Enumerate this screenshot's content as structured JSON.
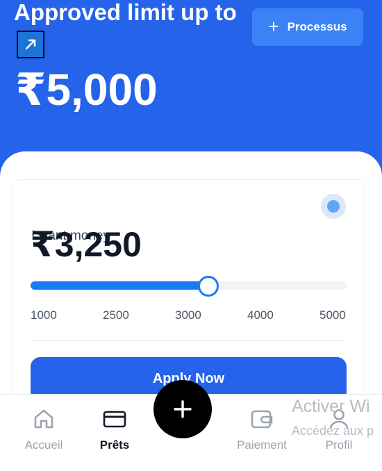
{
  "header": {
    "title": "Approved limit up to",
    "limit_amount": "₹5,000",
    "process_button_label": "Processus"
  },
  "loan_card": {
    "want_label": "I want money",
    "amount": "₹3,250",
    "slider": {
      "min": 1000,
      "max": 5000,
      "value": 3250,
      "fill_percent": 56,
      "ticks": [
        "1000",
        "2500",
        "3000",
        "4000",
        "5000"
      ]
    },
    "apply_label": "Apply Now"
  },
  "bottom_nav": {
    "items": [
      {
        "label": "Accueil",
        "icon": "home-icon",
        "active": false
      },
      {
        "label": "Prêts",
        "icon": "credit-card-icon",
        "active": true
      },
      {
        "label": "Paiement",
        "icon": "wallet-icon",
        "active": false
      },
      {
        "label": "Profil",
        "icon": "user-icon",
        "active": false
      }
    ]
  },
  "watermark": {
    "line1": "Activer Wi",
    "line2": "Accédez aux p"
  },
  "colors": {
    "primary": "#2563eb",
    "slider_fill": "#1a7cf5",
    "fab": "#000000",
    "status_dot": "#60a5fa"
  }
}
